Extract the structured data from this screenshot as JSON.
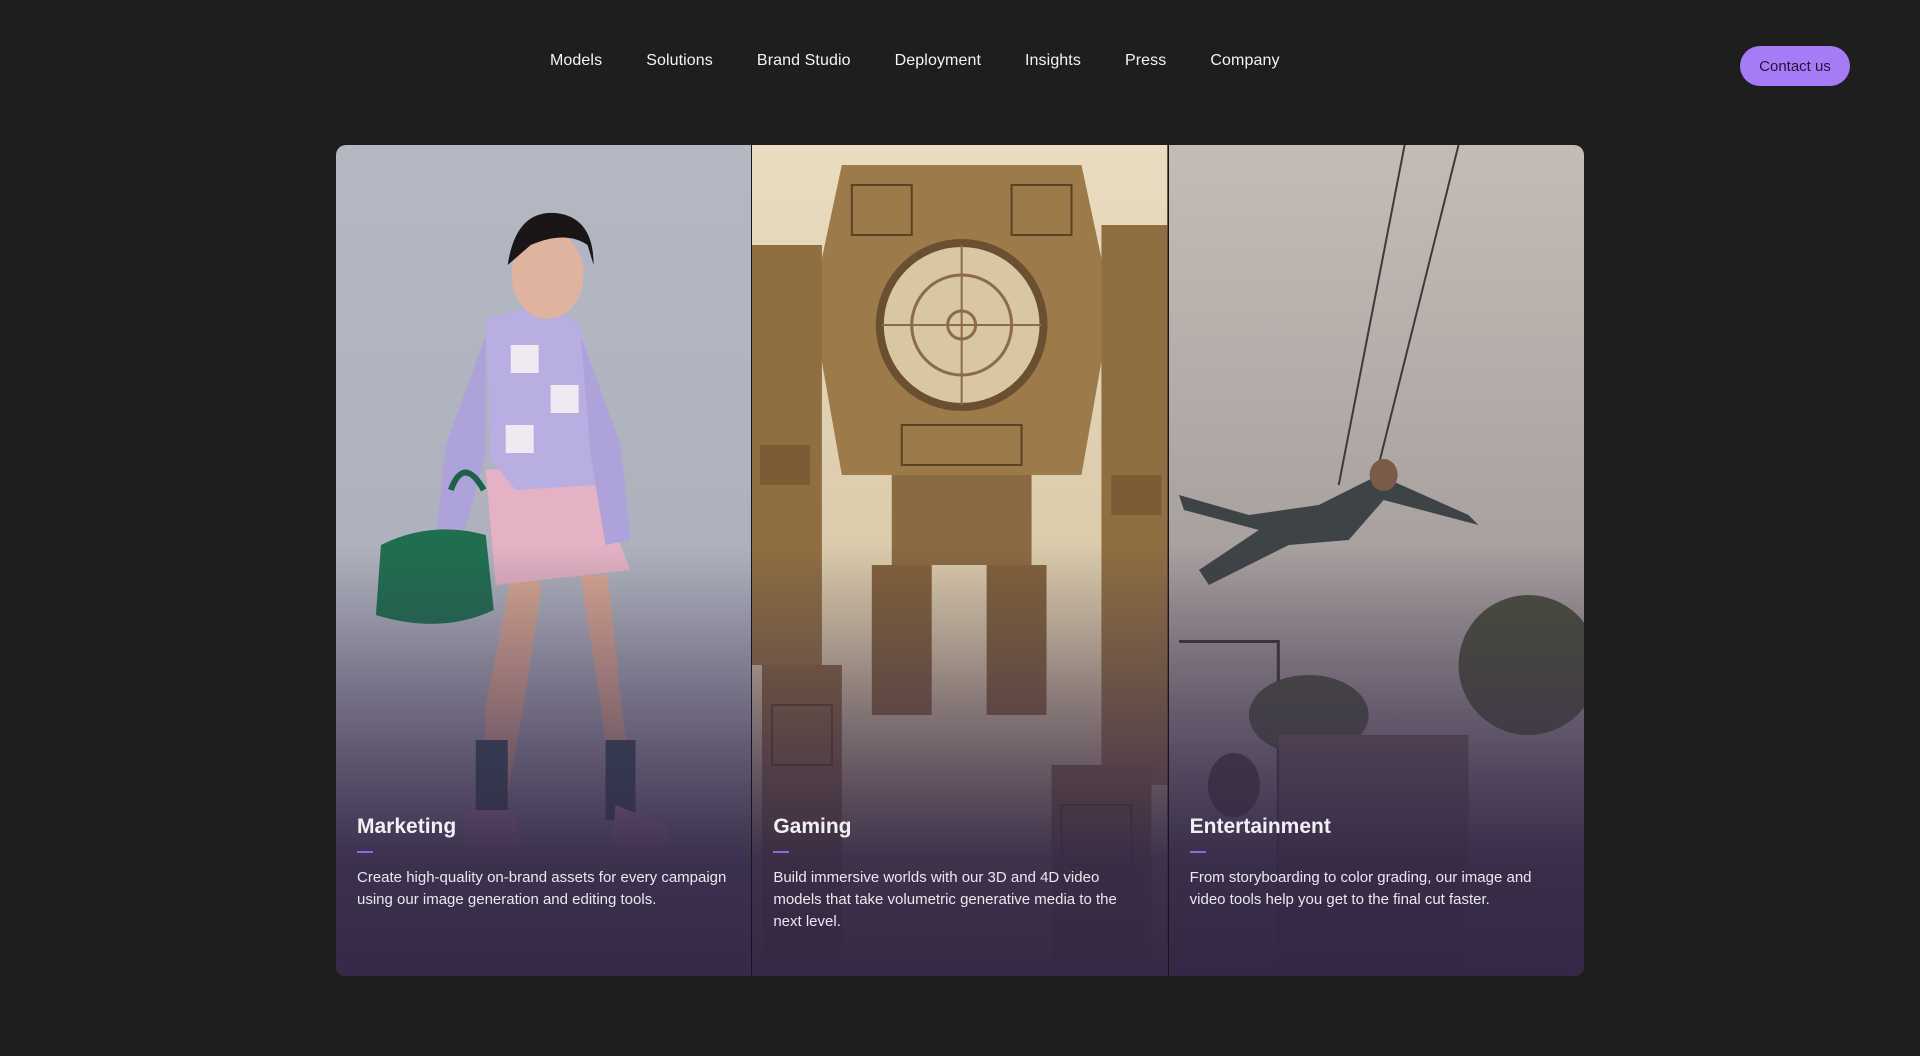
{
  "nav": {
    "links": [
      "Models",
      "Solutions",
      "Brand Studio",
      "Deployment",
      "Insights",
      "Press",
      "Company"
    ],
    "contact_label": "Contact us"
  },
  "cards": [
    {
      "title": "Marketing",
      "description": "Create high-quality on-brand assets for every campaign using our image generation and editing tools.",
      "image": "fashion-model-photo"
    },
    {
      "title": "Gaming",
      "description": "Build immersive worlds with our 3D and 4D video models that take volumetric generative media to the next level.",
      "image": "giant-robot-sketch"
    },
    {
      "title": "Entertainment",
      "description": "From storyboarding to color grading, our image and video tools help you get to the final cut faster.",
      "image": "flying-stuntman-photo"
    }
  ],
  "colors": {
    "background": "#1e1e1f",
    "accent": "#a57cf6",
    "rule": "#8f68e0"
  }
}
